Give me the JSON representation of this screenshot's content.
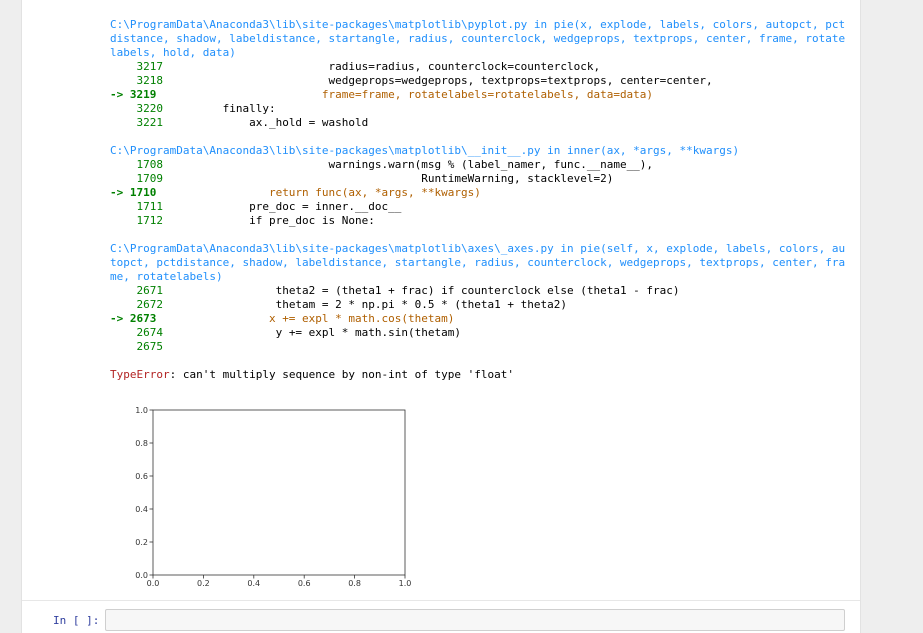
{
  "traceback": {
    "frame1": {
      "header": "C:\\ProgramData\\Anaconda3\\lib\\site-packages\\matplotlib\\pyplot.py in pie(x, explode, labels, colors, autopct, pctdistance, shadow, labeldistance, startangle, radius, counterclock, wedgeprops, textprops, center, frame, rotatelabels, hold, data)",
      "lines": [
        "    3217                         radius=radius, counterclock=counterclock,",
        "    3218                         wedgeprops=wedgeprops, textprops=textprops, center=center,",
        "-> 3219                         frame=frame, rotatelabels=rotatelabels, data=data)",
        "    3220         finally:",
        "    3221             ax._hold = washold"
      ]
    },
    "frame2": {
      "header": "C:\\ProgramData\\Anaconda3\\lib\\site-packages\\matplotlib\\__init__.py in inner(ax, *args, **kwargs)",
      "lines": [
        "    1708                         warnings.warn(msg % (label_namer, func.__name__),",
        "    1709                                       RuntimeWarning, stacklevel=2)",
        "-> 1710                 return func(ax, *args, **kwargs)",
        "    1711             pre_doc = inner.__doc__",
        "    1712             if pre_doc is None:"
      ]
    },
    "frame3": {
      "header": "C:\\ProgramData\\Anaconda3\\lib\\site-packages\\matplotlib\\axes\\_axes.py in pie(self, x, explode, labels, colors, autopct, pctdistance, shadow, labeldistance, startangle, radius, counterclock, wedgeprops, textprops, center, frame, rotatelabels)",
      "lines": [
        "    2671                 theta2 = (theta1 + frac) if counterclock else (theta1 - frac)",
        "    2672                 thetam = 2 * np.pi * 0.5 * (theta1 + theta2)",
        "-> 2673                 x += expl * math.cos(thetam)",
        "    2674                 y += expl * math.sin(thetam)",
        "    2675"
      ]
    },
    "error_name": "TypeError",
    "error_message": ": can't multiply sequence by non-int of type 'float'"
  },
  "chart_data": {
    "type": "scatter",
    "x": [],
    "y": [],
    "xlim": [
      0.0,
      1.0
    ],
    "ylim": [
      0.0,
      1.0
    ],
    "xticks": [
      "0.0",
      "0.2",
      "0.4",
      "0.6",
      "0.8",
      "1.0"
    ],
    "yticks": [
      "0.0",
      "0.2",
      "0.4",
      "0.6",
      "0.8",
      "1.0"
    ],
    "grid": false
  },
  "input_cell": {
    "prompt": "In [ ]:",
    "value": ""
  }
}
